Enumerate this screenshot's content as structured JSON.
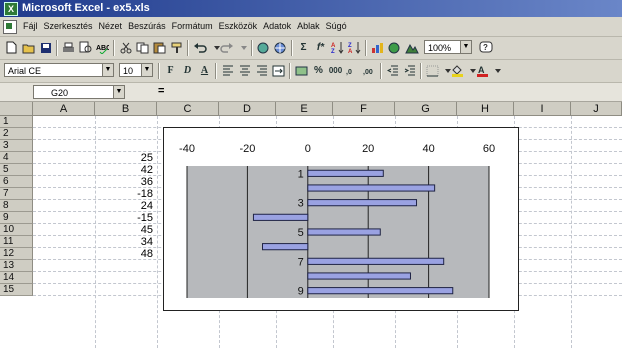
{
  "window": {
    "title": "Microsoft Excel - ex5.xls"
  },
  "menu": [
    "Fájl",
    "Szerkesztés",
    "Nézet",
    "Beszúrás",
    "Formátum",
    "Eszközök",
    "Adatok",
    "Ablak",
    "Súgó"
  ],
  "toolbar": {
    "zoom": "100%",
    "font_name": "Arial CE",
    "font_size": "10",
    "bold": "F",
    "italic": "D",
    "underline": "A",
    "percent": "%",
    "thousands": "000",
    "sum": "Σ",
    "function": "f*",
    "icons": [
      "new-icon",
      "open-icon",
      "save-icon",
      "print-icon",
      "print-preview-icon",
      "spelling-icon",
      "cut-icon",
      "copy-icon",
      "paste-icon",
      "format-painter-icon",
      "undo-icon",
      "redo-icon",
      "hyperlink-icon",
      "web-toolbar-icon",
      "autosum-icon",
      "function-icon",
      "sort-ascending-icon",
      "sort-descending-icon",
      "chart-wizard-icon",
      "map-icon",
      "drawing-icon",
      "help-icon"
    ]
  },
  "formula_bar": {
    "name_box": "G20",
    "equals": "="
  },
  "columns": [
    "A",
    "B",
    "C",
    "D",
    "E",
    "F",
    "G",
    "H",
    "I",
    "J"
  ],
  "rows": [
    "1",
    "2",
    "3",
    "4",
    "5",
    "6",
    "7",
    "8",
    "9",
    "10",
    "11",
    "12",
    "13",
    "14",
    "15"
  ],
  "cells_b": [
    {
      "row": "4",
      "value": "25"
    },
    {
      "row": "5",
      "value": "42"
    },
    {
      "row": "6",
      "value": "36"
    },
    {
      "row": "7",
      "value": "-18"
    },
    {
      "row": "8",
      "value": "24"
    },
    {
      "row": "9",
      "value": "-15"
    },
    {
      "row": "10",
      "value": "45"
    },
    {
      "row": "11",
      "value": "34"
    },
    {
      "row": "12",
      "value": "48"
    }
  ],
  "chart_data": {
    "type": "bar",
    "orientation": "horizontal",
    "categories": [
      "1",
      "2",
      "3",
      "4",
      "5",
      "6",
      "7",
      "8",
      "9"
    ],
    "category_labels_shown": [
      "1",
      "3",
      "5",
      "7",
      "9"
    ],
    "values": [
      25,
      42,
      36,
      -18,
      24,
      -15,
      45,
      34,
      48
    ],
    "xlim": [
      -40,
      60
    ],
    "xticks": [
      "-40",
      "-20",
      "0",
      "20",
      "40",
      "60"
    ],
    "axis_position": "top",
    "gridlines": true,
    "legend": "none",
    "colors": {
      "plot_area": "#b7b9bc",
      "bar": "#9aa2e2",
      "bar_outline": "#1f2345"
    }
  }
}
